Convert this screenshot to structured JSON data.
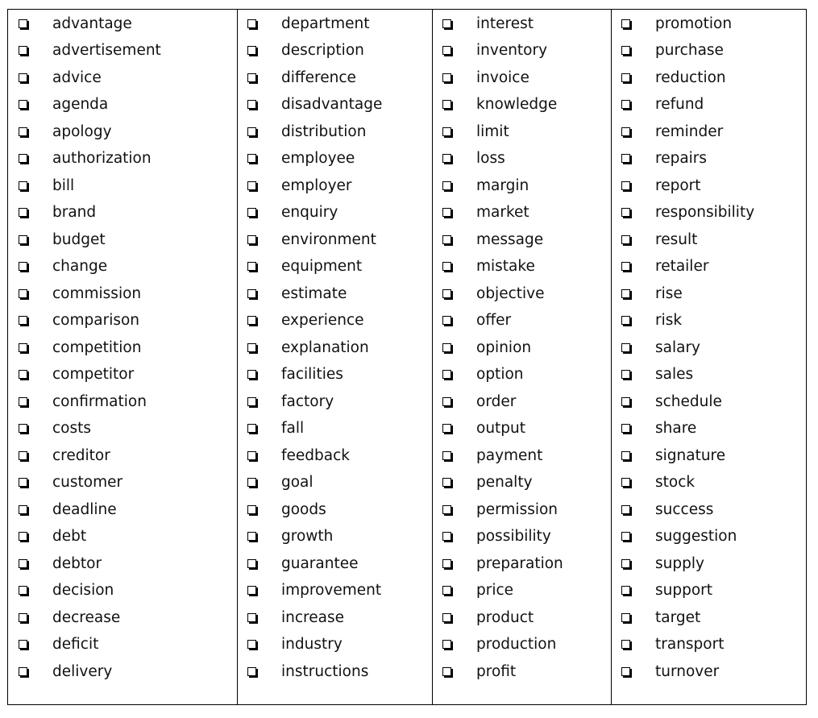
{
  "columns": [
    {
      "items": [
        "advantage",
        "advertisement",
        "advice",
        "agenda",
        "apology",
        "authorization",
        "bill",
        "brand",
        "budget",
        "change",
        "commission",
        "comparison",
        "competition",
        "competitor",
        "confirmation",
        "costs",
        "creditor",
        "customer",
        "deadline",
        "debt",
        "debtor",
        "decision",
        "decrease",
        "deficit",
        "delivery"
      ]
    },
    {
      "items": [
        "department",
        "description",
        "difference",
        "disadvantage",
        "distribution",
        "employee",
        "employer",
        "enquiry",
        "environment",
        "equipment",
        "estimate",
        "experience",
        "explanation",
        "facilities",
        "factory",
        "fall",
        "feedback",
        "goal",
        "goods",
        "growth",
        "guarantee",
        "improvement",
        "increase",
        "industry",
        "instructions"
      ]
    },
    {
      "items": [
        "interest",
        "inventory",
        "invoice",
        "knowledge",
        "limit",
        "loss",
        "margin",
        "market",
        "message",
        "mistake",
        "objective",
        "offer",
        "opinion",
        "option",
        "order",
        "output",
        "payment",
        "penalty",
        "permission",
        "possibility",
        "preparation",
        "price",
        "product",
        "production",
        "profit"
      ]
    },
    {
      "items": [
        "promotion",
        "purchase",
        "reduction",
        "refund",
        "reminder",
        "repairs",
        "report",
        "responsibility",
        "result",
        "retailer",
        "rise",
        "risk",
        "salary",
        "sales",
        "schedule",
        "share",
        "signature",
        "stock",
        "success",
        "suggestion",
        "supply",
        "support",
        "target",
        "transport",
        "turnover"
      ]
    }
  ],
  "checkbox_icon": "shadowed-square-checkbox"
}
